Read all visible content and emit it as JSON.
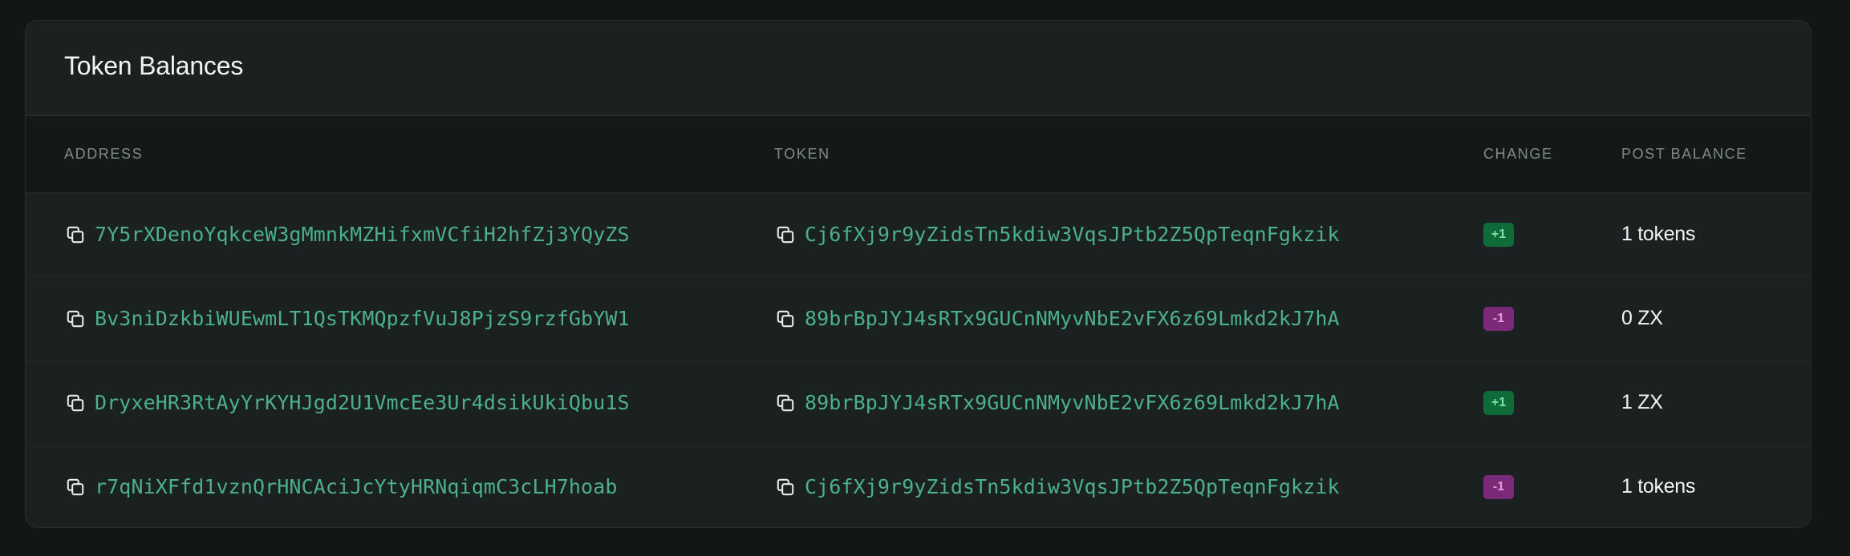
{
  "card": {
    "title": "Token Balances"
  },
  "table": {
    "headers": {
      "address": "ADDRESS",
      "token": "TOKEN",
      "change": "CHANGE",
      "post_balance": "POST BALANCE"
    },
    "rows": [
      {
        "address": "7Y5rXDenoYqkceW3gMmnkMZHifxmVCfiH2hfZj3YQyZS",
        "token": "Cj6fXj9r9yZidsTn5kdiw3VqsJPtb2Z5QpTeqnFgkzik",
        "change": "+1",
        "change_type": "positive",
        "post_balance": "1 tokens"
      },
      {
        "address": "Bv3niDzkbiWUEwmLT1QsTKMQpzfVuJ8PjzS9rzfGbYW1",
        "token": "89brBpJYJ4sRTx9GUCnNMyvNbE2vFX6z69Lmkd2kJ7hA",
        "change": "-1",
        "change_type": "negative",
        "post_balance": "0 ZX"
      },
      {
        "address": "DryxeHR3RtAyYrKYHJgd2U1VmcEe3Ur4dsikUkiQbu1S",
        "token": "89brBpJYJ4sRTx9GUCnNMyvNbE2vFX6z69Lmkd2kJ7hA",
        "change": "+1",
        "change_type": "positive",
        "post_balance": "1 ZX"
      },
      {
        "address": "r7qNiXFfd1vznQrHNCAciJcYtyHRNqiqmC3cLH7hoab",
        "token": "Cj6fXj9r9yZidsTn5kdiw3VqsJPtb2Z5QpTeqnFgkzik",
        "change": "-1",
        "change_type": "negative",
        "post_balance": "1 tokens"
      }
    ]
  },
  "icons": {
    "copy": "copy-icon"
  },
  "colors": {
    "background": "#121615",
    "card": "#1b2020",
    "hash_text": "#4cb08a",
    "positive_badge": "#0f6b3a",
    "negative_badge": "#7a2a77"
  }
}
